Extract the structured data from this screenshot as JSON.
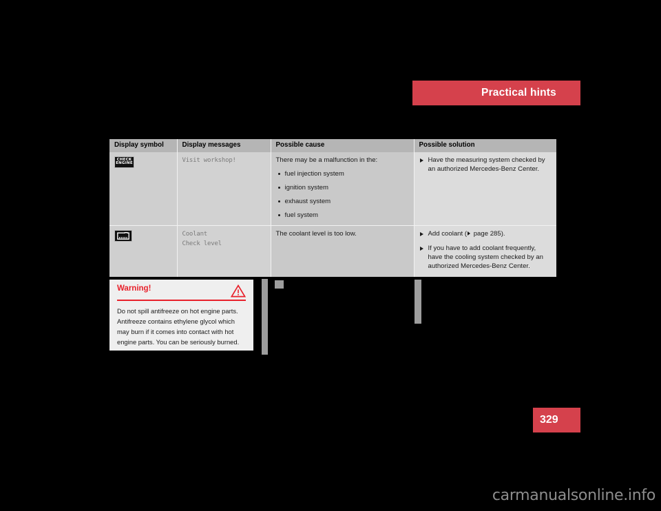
{
  "header": {
    "title": "Practical hints",
    "accent_color": "#d5414c"
  },
  "table": {
    "columns": [
      "Display symbol",
      "Display messages",
      "Possible cause",
      "Possible solution"
    ],
    "rows": [
      {
        "symbol_name": "check-engine-icon",
        "symbol_text_line1": "CHECK",
        "symbol_text_line2": "ENGINE",
        "message_line1": "Visit workshop!",
        "message_line2": "",
        "cause_lead": "There may be a malfunction in the:",
        "cause_items": [
          "fuel injection system",
          "ignition system",
          "exhaust system",
          "fuel system"
        ],
        "solutions": [
          {
            "text_before": "Have the measuring system checked by an authorized Mercedes-Benz Center.",
            "text_after": ""
          }
        ]
      },
      {
        "symbol_name": "coolant-level-icon",
        "symbol_text_line1": "",
        "symbol_text_line2": "",
        "message_line1": "Coolant",
        "message_line2": "Check level",
        "cause_lead": "The coolant level is too low.",
        "cause_items": [],
        "solutions": [
          {
            "text_before": "Add coolant (",
            "text_after": " page 285)."
          },
          {
            "text_before": "If you have to add coolant frequently, have the cooling system checked by an authorized Mercedes-Benz Center.",
            "text_after": ""
          }
        ]
      }
    ]
  },
  "warning": {
    "title": "Warning!",
    "icon": "warning-triangle-icon",
    "body": "Do not spill antifreeze on hot engine parts. Antifreeze contains ethylene glycol which may burn if it comes into contact with hot engine parts. You can be seriously burned.",
    "accent_color": "#e8202a"
  },
  "page": {
    "number": "329"
  },
  "watermark": {
    "text": "carmanualsonline.info"
  }
}
